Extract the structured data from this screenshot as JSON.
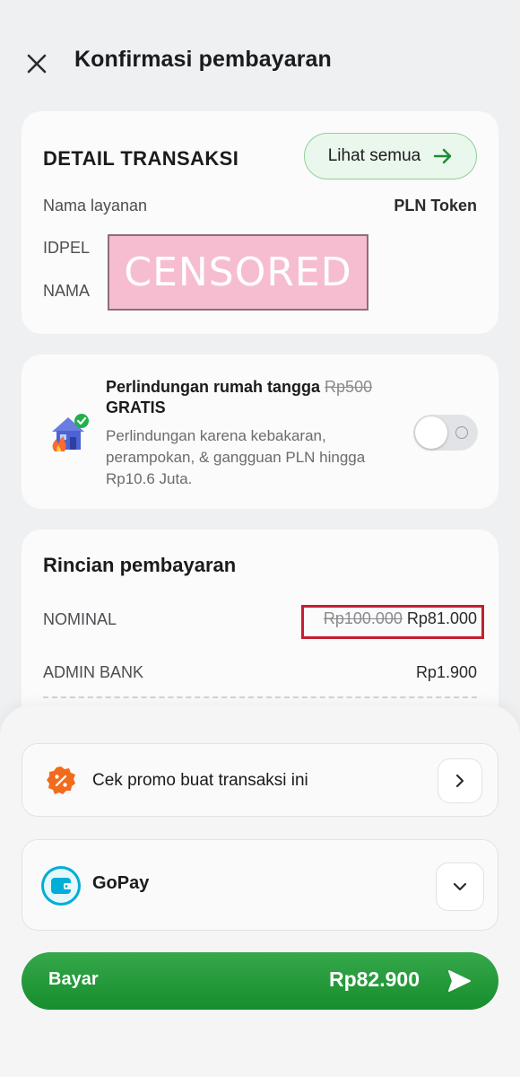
{
  "header": {
    "title": "Konfirmasi pembayaran",
    "close_icon": "close-icon"
  },
  "detail": {
    "title": "DETAIL TRANSAKSI",
    "see_all_label": "Lihat semua",
    "rows": [
      {
        "label": "Nama layanan",
        "value": "PLN Token"
      },
      {
        "label": "IDPEL",
        "value": ""
      },
      {
        "label": "NAMA",
        "value": ""
      }
    ],
    "censor_text": "CENSORED"
  },
  "protection": {
    "title": "Perlindungan rumah tangga",
    "old_price": "Rp500",
    "free_label": "GRATIS",
    "description": "Perlindungan karena kebakaran, perampokan, & gangguan PLN hingga Rp10.6 Juta.",
    "toggle_on": false
  },
  "rincian": {
    "title": "Rincian pembayaran",
    "rows": [
      {
        "label": "NOMINAL",
        "old_value": "Rp100.000",
        "value": "Rp81.000"
      },
      {
        "label": "ADMIN BANK",
        "value": "Rp1.900"
      }
    ]
  },
  "bottom": {
    "promo_label": "Cek promo buat transaksi ini",
    "payment_method": "GoPay",
    "pay_label": "Bayar",
    "pay_amount": "Rp82.900"
  },
  "colors": {
    "accent_green": "#178d2e",
    "promo_orange": "#f26b1d",
    "gopay_blue": "#00aed6",
    "highlight_red": "#c41f2e"
  }
}
